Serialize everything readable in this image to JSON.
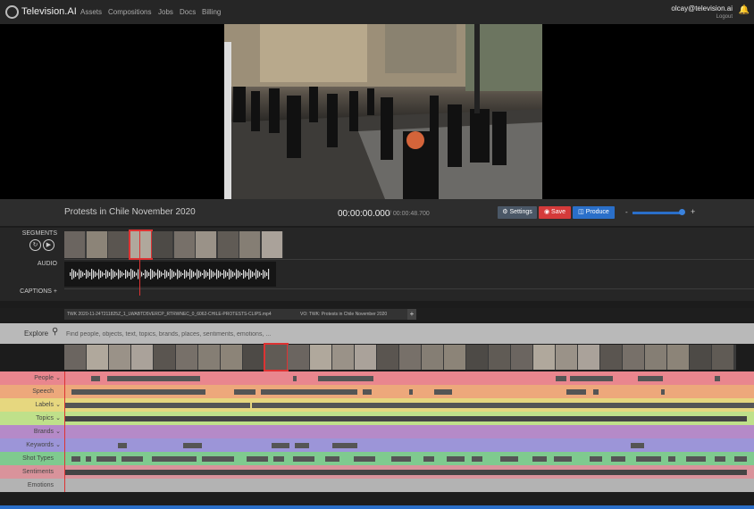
{
  "nav": {
    "brand": "Television.AI",
    "links": [
      "Assets",
      "Compositions",
      "Jobs",
      "Docs",
      "Billing"
    ],
    "user": "olcay@television.ai",
    "logout": "Logout"
  },
  "player": {
    "title": "Protests in Chile November 2020",
    "timecode": "00:00:00.000",
    "duration": "/ 00:00:48.700",
    "settings_label": "Settings",
    "save_label": "Save",
    "produce_label": "Produce",
    "volume_level": 0.95,
    "vol_minus": "-",
    "vol_plus": "+"
  },
  "editor": {
    "segments_label": "SEGMENTS",
    "audio_label": "AUDIO",
    "captions_label": "CAPTIONS +"
  },
  "tabs": {
    "file_tab": "TWK 2020-11-24T211825Z_1_LWABTD5VERCP_RTRWNEC_0_6062-CHILE-PROTESTS-CLIPS.mp4",
    "vo_tab": "VO: TWK: Protests in Chile November 2020",
    "add": "+"
  },
  "explore": {
    "label": "Explore",
    "placeholder": "Find people, objects, text, topics, brands, places, sentiments, emotions, ..."
  },
  "tracks": [
    {
      "name": "People",
      "color": "#e9868e",
      "chevron": true
    },
    {
      "name": "Speech",
      "color": "#eda87b",
      "chevron": false
    },
    {
      "name": "Labels",
      "color": "#e6d77f",
      "chevron": true
    },
    {
      "name": "Topics",
      "color": "#bfe08a",
      "chevron": true
    },
    {
      "name": "Brands",
      "color": "#b58ac8",
      "chevron": true
    },
    {
      "name": "Keywords",
      "color": "#9c95d8",
      "chevron": true
    },
    {
      "name": "Shot Types",
      "color": "#7fca8f",
      "chevron": false
    },
    {
      "name": "Sentiments",
      "color": "#d9939b",
      "chevron": false
    },
    {
      "name": "Emotions",
      "color": "#b3b3b3",
      "chevron": false
    }
  ],
  "colors": {
    "save": "#d43a3a",
    "produce": "#2a6fc9",
    "playhead": "#dd3333"
  }
}
